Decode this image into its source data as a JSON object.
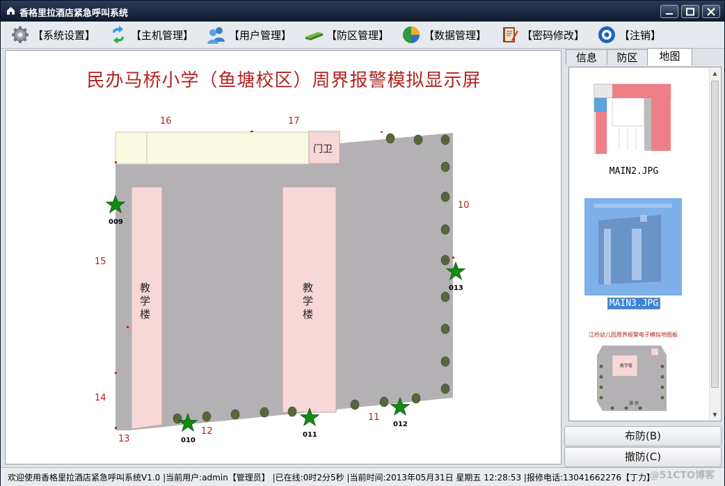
{
  "window": {
    "title": "香格里拉酒店紧急呼叫系统"
  },
  "menu": [
    {
      "label": "【系统设置】",
      "icon": "gear-icon"
    },
    {
      "label": "【主机管理】",
      "icon": "sync-arrows-icon"
    },
    {
      "label": "【用户管理】",
      "icon": "users-icon"
    },
    {
      "label": "【防区管理】",
      "icon": "zone-icon"
    },
    {
      "label": "【数据管理】",
      "icon": "pie-chart-icon"
    },
    {
      "label": "【密码修改】",
      "icon": "notebook-pen-icon"
    },
    {
      "label": "【注销】",
      "icon": "power-disc-icon"
    }
  ],
  "map": {
    "title": "民办马桥小学（鱼塘校区）周界报警模拟显示屏",
    "gate_label": "门卫",
    "buildings": [
      "教学楼",
      "教学楼"
    ],
    "zone_numbers": [
      "10",
      "11",
      "12",
      "13",
      "14",
      "15",
      "16",
      "17"
    ],
    "alarm_points": [
      "009",
      "010",
      "011",
      "012",
      "013"
    ],
    "colors": {
      "title": "#b3221e",
      "ground": "#b4b1b5",
      "building": "#f8d7d8",
      "star": "#138a13",
      "strip": "#fafae3"
    }
  },
  "tabs": [
    {
      "label": "信息",
      "active": false
    },
    {
      "label": "防区",
      "active": false
    },
    {
      "label": "地图",
      "active": true
    }
  ],
  "maps_list": [
    {
      "name": "MAIN2.JPG",
      "selected": false
    },
    {
      "name": "MAIN3.JPG",
      "selected": true
    },
    {
      "name": "",
      "caption": "江桥幼儿园周界报警电子模拟地图板",
      "selected": false,
      "label": "教学楼",
      "label2": "操 场"
    }
  ],
  "buttons": {
    "arm": "布防(B)",
    "disarm": "撤防(C)"
  },
  "status": {
    "text": "欢迎使用香格里拉酒店紧急呼叫系统V1.0 |当前用户:admin【管理员】 |已在线:0时2分5秒 |当前时间:2013年05月31日 星期五 12:28:53 |报修电话:13041662276【丁力】",
    "watermark": "@51CTO博客"
  }
}
